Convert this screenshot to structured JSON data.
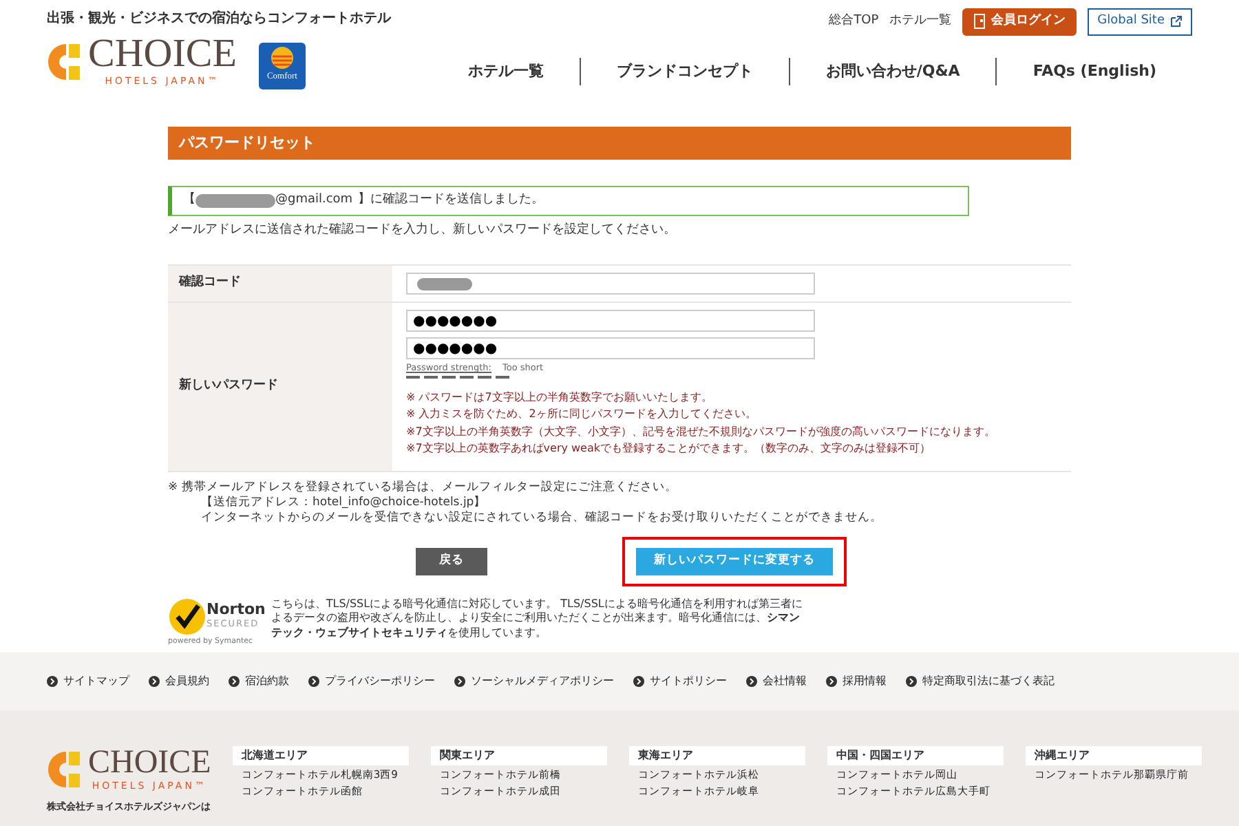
{
  "header": {
    "tagline": "出張・観光・ビジネスでの宿泊ならコンフォートホテル",
    "logo": {
      "wordmark": "CHOICE",
      "subtitle": "HOTELS JAPAN™"
    },
    "brand_badge": "Comfort",
    "top_links": [
      "総合TOP",
      "ホテル一覧"
    ],
    "login_button": "会員ログイン",
    "global_button": "Global Site",
    "nav": [
      "ホテル一覧",
      "ブランドコンセプト",
      "お問い合わせ/Q&A",
      "FAQs (English)"
    ]
  },
  "page_title": "パスワードリセット",
  "notice": {
    "prefix": "【",
    "email_suffix": "@gmail.com",
    "suffix": "】に確認コードを送信しました。"
  },
  "instruction": "メールアドレスに送信された確認コードを入力し、新しいパスワードを設定してください。",
  "form_rows": [
    {
      "kind": "code",
      "label": "確認コード"
    },
    {
      "kind": "password",
      "label": "新しいパスワード",
      "fields": [
        "●●●●●●●",
        "●●●●●●●"
      ],
      "strength_label": "Password strength:",
      "strength_value": "Too short",
      "rules": [
        "※ パスワードは7文字以上の半角英数字でお願いいたします。",
        "※ 入力ミスを防ぐため、2ヶ所に同じパスワードを入力してください。",
        "※7文字以上の半角英数字（大文字、小文字）、記号を混ぜた不規則なパスワードが強度の高いパスワードになります。",
        "※7文字以上の英数字あればvery weakでも登録することができます。（数字のみ、文字のみは登録不可）"
      ]
    }
  ],
  "notes": [
    "※ 携帯メールアドレスを登録されている場合は、メールフィルター設定にご注意ください。",
    "【送信元アドレス：hotel_info@choice-hotels.jp】",
    "インターネットからのメールを受信できない設定にされている場合、確認コードをお受け取りいただくことができません。"
  ],
  "buttons": [
    {
      "kind": "back",
      "label": "戻る",
      "highlighted": false
    },
    {
      "kind": "submit",
      "label": "新しいパスワードに変更する",
      "highlighted": true
    }
  ],
  "security": {
    "badge_brand": "Norton",
    "badge_status": "SECURED",
    "powered_by": "powered by Symantec",
    "text": "こちらは、TLS/SSLによる暗号化通信に対応しています。 TLS/SSLによる暗号化通信を利用すれば第三者によるデータの盗用や改ざんを防止し、より安全にご利用いただくことが出来ます。暗号化通信には、**シマンテック・ウェブサイトセキュリティ**を使用しています。"
  },
  "footer_links": [
    "サイトマップ",
    "会員規約",
    "宿泊約款",
    "プライバシーポリシー",
    "ソーシャルメディアポリシー",
    "サイトポリシー",
    "会社情報",
    "採用情報",
    "特定商取引法に基づく表記"
  ],
  "footer": {
    "logo": {
      "wordmark": "CHOICE",
      "subtitle": "HOTELS JAPAN™"
    },
    "company": "株式会社チョイスホテルズジャパンは",
    "areas": [
      {
        "title": "北海道エリア",
        "hotels": [
          "コンフォートホテル札幌南3西9",
          "コンフォートホテル函館"
        ]
      },
      {
        "title": "関東エリア",
        "hotels": [
          "コンフォートホテル前橋",
          "コンフォートホテル成田"
        ]
      },
      {
        "title": "東海エリア",
        "hotels": [
          "コンフォートホテル浜松",
          "コンフォートホテル岐阜"
        ]
      },
      {
        "title": "中国・四国エリア",
        "hotels": [
          "コンフォートホテル岡山",
          "コンフォートホテル広島大手町"
        ]
      },
      {
        "title": "沖縄エリア",
        "hotels": [
          "コンフォートホテル那覇県庁前"
        ]
      }
    ]
  }
}
